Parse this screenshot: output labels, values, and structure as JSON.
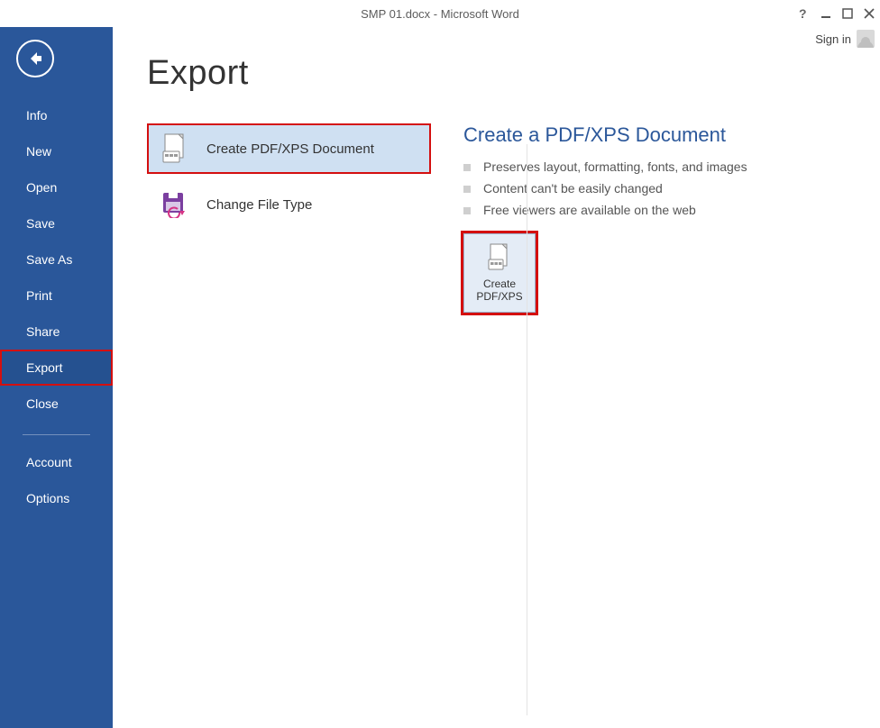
{
  "window": {
    "title": "SMP 01.docx - Microsoft Word"
  },
  "signin": {
    "label": "Sign in"
  },
  "sidebar": {
    "items": [
      {
        "label": "Info"
      },
      {
        "label": "New"
      },
      {
        "label": "Open"
      },
      {
        "label": "Save"
      },
      {
        "label": "Save As"
      },
      {
        "label": "Print"
      },
      {
        "label": "Share"
      },
      {
        "label": "Export"
      },
      {
        "label": "Close"
      }
    ],
    "footer": [
      {
        "label": "Account"
      },
      {
        "label": "Options"
      }
    ]
  },
  "main": {
    "title": "Export",
    "options": [
      {
        "label": "Create PDF/XPS Document"
      },
      {
        "label": "Change File Type"
      }
    ],
    "detail": {
      "heading": "Create a PDF/XPS Document",
      "bullets": [
        "Preserves layout, formatting, fonts, and images",
        "Content can't be easily changed",
        "Free viewers are available on the web"
      ],
      "button_label": "Create\nPDF/XPS"
    }
  }
}
